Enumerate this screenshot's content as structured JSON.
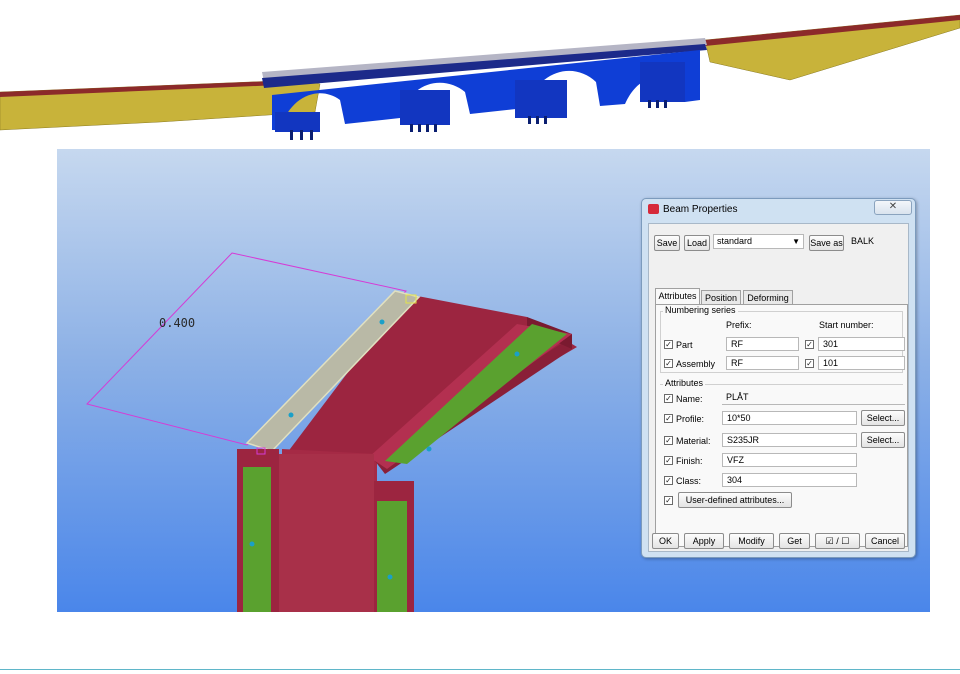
{
  "model": {
    "dimension_label": "0.400"
  },
  "dialog": {
    "title": "Beam Properties",
    "close_symbol": "✕",
    "toolbar": {
      "save_label": "Save",
      "load_label": "Load",
      "preset_value": "standard",
      "save_as_label": "Save as",
      "save_as_value": "BALK"
    },
    "tabs": [
      {
        "label": "Attributes",
        "active": true
      },
      {
        "label": "Position",
        "active": false
      },
      {
        "label": "Deforming",
        "active": false
      }
    ],
    "numbering": {
      "group_label": "Numbering series",
      "prefix_header": "Prefix:",
      "start_header": "Start number:",
      "rows": [
        {
          "label": "Part",
          "prefix": "RF",
          "start": "301"
        },
        {
          "label": "Assembly",
          "prefix": "RF",
          "start": "101"
        }
      ]
    },
    "attributes": {
      "group_label": "Attributes",
      "name_label": "Name:",
      "name_value": "PLÅT",
      "profile_label": "Profile:",
      "profile_value": "10*50",
      "material_label": "Material:",
      "material_value": "S235JR",
      "finish_label": "Finish:",
      "finish_value": "VFZ",
      "class_label": "Class:",
      "class_value": "304",
      "select_label": "Select...",
      "user_defined_label": "User-defined attributes..."
    },
    "footer": {
      "ok_label": "OK",
      "apply_label": "Apply",
      "modify_label": "Modify",
      "get_label": "Get",
      "toggle_label": "☑ / ☐",
      "cancel_label": "Cancel"
    }
  },
  "colors": {
    "bridge_blue": "#0f3ed6",
    "terrain_olive": "#c8b33a",
    "beam_red": "#9c2540",
    "plate_green": "#5aa12f",
    "plate_grey": "#b9b9a6",
    "dimension_magenta": "#d53bd6"
  }
}
